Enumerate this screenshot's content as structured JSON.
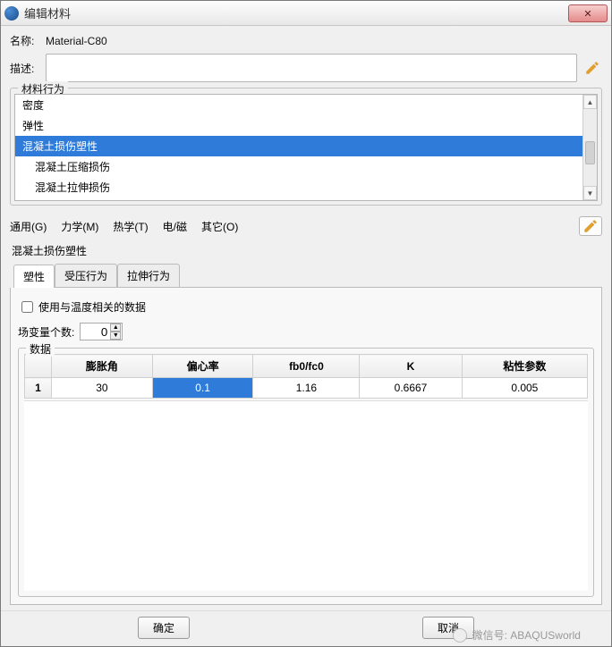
{
  "window": {
    "title": "编辑材料"
  },
  "labels": {
    "name": "名称:",
    "desc": "描述:",
    "behavior_group": "材料行为",
    "section": "混凝土损伤塑性",
    "checkbox": "使用与温度相关的数据",
    "field_count": "场变量个数:",
    "data_group": "数据"
  },
  "name_value": "Material-C80",
  "desc_value": "",
  "behaviors": {
    "items": [
      {
        "label": "密度",
        "sub": false,
        "selected": false
      },
      {
        "label": "弹性",
        "sub": false,
        "selected": false
      },
      {
        "label": "混凝土损伤塑性",
        "sub": false,
        "selected": true
      },
      {
        "label": "混凝土压缩损伤",
        "sub": true,
        "selected": false
      },
      {
        "label": "混凝土拉伸损伤",
        "sub": true,
        "selected": false
      }
    ]
  },
  "menus": {
    "general": "通用(G)",
    "mechanical": "力学(M)",
    "thermal": "热学(T)",
    "em": "电/磁",
    "other": "其它(O)"
  },
  "tabs": {
    "t0": "塑性",
    "t1": "受压行为",
    "t2": "拉伸行为"
  },
  "field_count_value": "0",
  "chart_data": {
    "type": "table",
    "headers": {
      "row": "1",
      "c0": "膨胀角",
      "c1": "偏心率",
      "c2": "fb0/fc0",
      "c3": "K",
      "c4": "粘性参数"
    },
    "rows": [
      {
        "row": "1",
        "c0": "30",
        "c1": "0.1",
        "c2": "1.16",
        "c3": "0.6667",
        "c4": "0.005",
        "selected_col": "c1"
      }
    ]
  },
  "buttons": {
    "ok": "确定",
    "cancel": "取消"
  },
  "watermark": "微信号: ABAQUSworld"
}
